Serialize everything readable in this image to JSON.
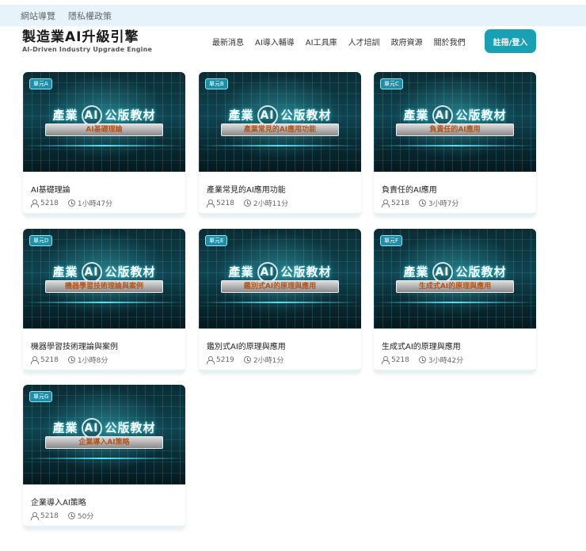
{
  "topbar": {
    "links": [
      "網站導覽",
      "隱私權政策"
    ]
  },
  "header": {
    "title": "製造業AI升級引擎",
    "subtitle": "AI-Driven Industry Upgrade Engine",
    "nav": [
      "最新消息",
      "AI導入輔導",
      "AI工具庫",
      "人才培訓",
      "政府資源",
      "關於我們"
    ],
    "login": "註冊/登入"
  },
  "colors": {
    "accent": "#1aa0b4",
    "topbar_bg": "#e7f3fb"
  },
  "thumbnail_common": {
    "title_left": "產業",
    "title_ai": "AI",
    "title_right": "公版教材"
  },
  "cards": [
    {
      "unit": "單元A",
      "banner": "AI基礎理論",
      "title": "AI基礎理論",
      "learners": "5218",
      "duration": "1小時47分"
    },
    {
      "unit": "單元B",
      "banner": "產業常見的AI應用功能",
      "title": "產業常見的AI應用功能",
      "learners": "5218",
      "duration": "2小時11分"
    },
    {
      "unit": "單元C",
      "banner": "負責任的AI應用",
      "title": "負責任的AI應用",
      "learners": "5218",
      "duration": "3小時7分"
    },
    {
      "unit": "單元D",
      "banner": "機器學習技術理論與案例",
      "title": "機器學習技術理論與案例",
      "learners": "5218",
      "duration": "1小時8分"
    },
    {
      "unit": "單元E",
      "banner": "鑑別式AI的原理與應用",
      "title": "鑑別式AI的原理與應用",
      "learners": "5219",
      "duration": "2小時1分"
    },
    {
      "unit": "單元F",
      "banner": "生成式AI的原理與應用",
      "title": "生成式AI的原理與應用",
      "learners": "5218",
      "duration": "3小時42分"
    },
    {
      "unit": "單元G",
      "banner": "企業導入AI策略",
      "title": "企業導入AI策略",
      "learners": "5218",
      "duration": "50分"
    }
  ]
}
